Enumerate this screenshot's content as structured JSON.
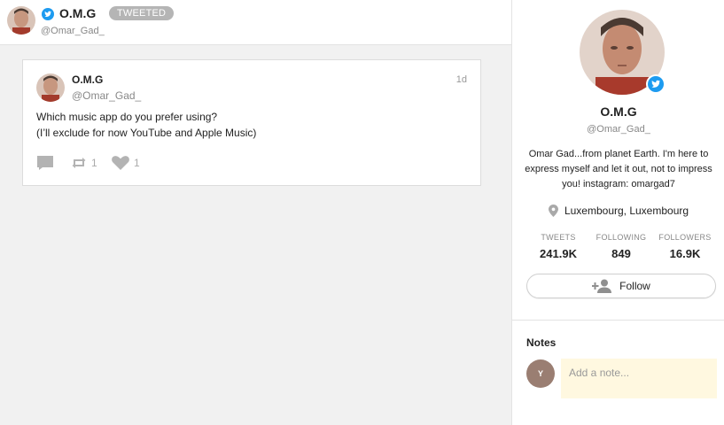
{
  "header": {
    "name": "O.M.G",
    "badge": "TWEETED",
    "handle": "@Omar_Gad_",
    "icons": [
      "avatar-photo",
      "twitter-bird-icon"
    ]
  },
  "tweet": {
    "name": "O.M.G",
    "handle": "@Omar_Gad_",
    "time": "1d",
    "text_line1": "Which music app do you prefer using?",
    "text_line2": "(I’ll exclude for now YouTube and Apple Music)",
    "retweets": "1",
    "likes": "1",
    "icons": [
      "reply-icon",
      "retweet-icon",
      "heart-icon"
    ]
  },
  "profile": {
    "name": "O.M.G",
    "handle": "@Omar_Gad_",
    "bio": "Omar Gad...from planet Earth. I'm here to express myself and let it out, not to impress you! instagram: omargad7",
    "location": "Luxembourg, Luxembourg",
    "stats": [
      {
        "label": "TWEETS",
        "value": "241.9K"
      },
      {
        "label": "FOLLOWING",
        "value": "849"
      },
      {
        "label": "FOLLOWERS",
        "value": "16.9K"
      }
    ],
    "follow_label": "Follow"
  },
  "notes": {
    "title": "Notes",
    "avatar_letter": "Y",
    "placeholder": "Add a note..."
  },
  "colors": {
    "twitter_blue": "#1d9bf0",
    "pill_gray": "#b5b5b5",
    "feed_bg": "#f1f1f1",
    "note_bg": "#fff8e0",
    "note_avatar": "#9a7e72"
  }
}
